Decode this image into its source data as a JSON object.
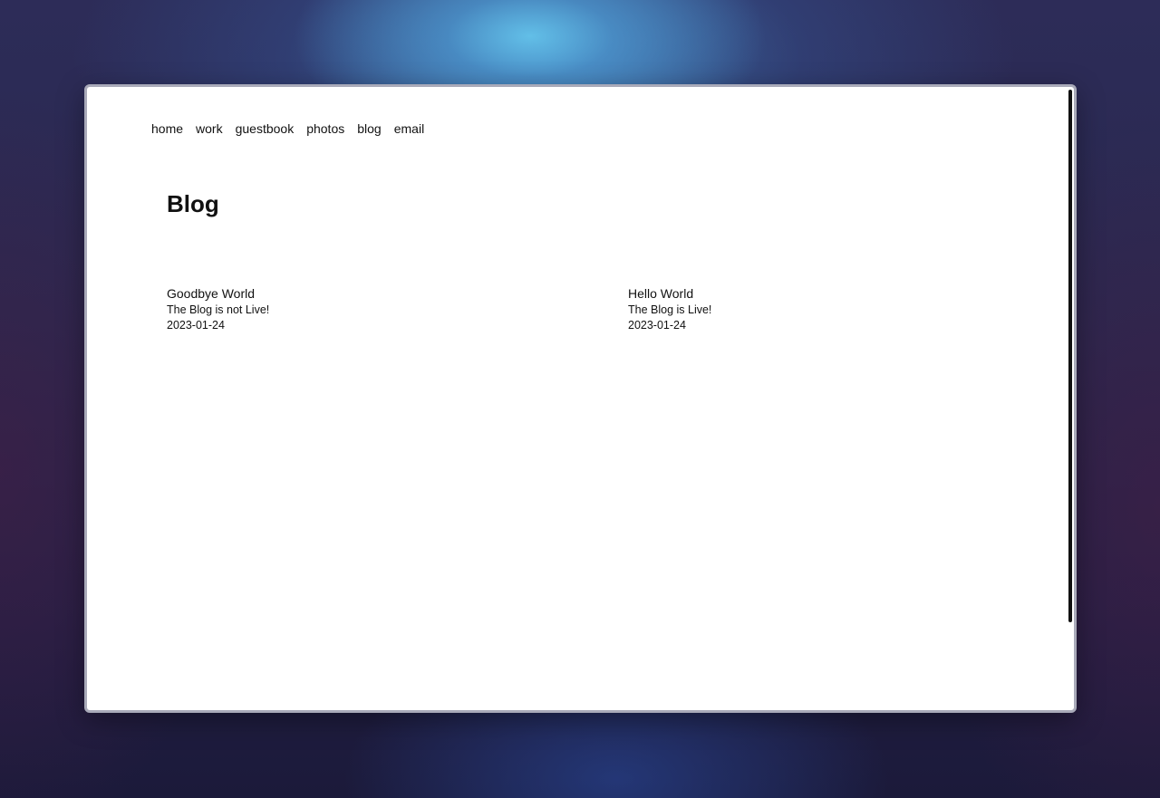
{
  "nav": {
    "items": [
      "home",
      "work",
      "guestbook",
      "photos",
      "blog",
      "email"
    ]
  },
  "page": {
    "title": "Blog"
  },
  "posts": [
    {
      "title": "Goodbye World",
      "description": "The Blog is not Live!",
      "date": "2023-01-24"
    },
    {
      "title": "Hello World",
      "description": "The Blog is Live!",
      "date": "2023-01-24"
    }
  ]
}
